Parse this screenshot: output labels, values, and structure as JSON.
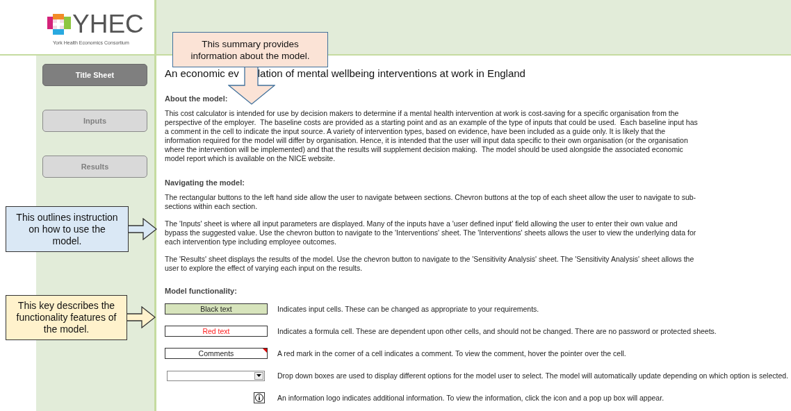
{
  "logo": {
    "name": "YHEC",
    "subtitle": "York Health Economics Consortium"
  },
  "nav": [
    {
      "label": "Title Sheet",
      "selected": true
    },
    {
      "label": "Inputs",
      "selected": false
    },
    {
      "label": "Results",
      "selected": false
    }
  ],
  "title_parts": [
    "An economic ev",
    "lation of mental wellbeing interventions at work in England"
  ],
  "sections": [
    {
      "heading": "About the model:",
      "paragraphs": [
        "This cost calculator is intended for use by decision makers to determine if a mental health intervention at work is cost-saving for a specific organisation from the perspective of the employer.  The baseline costs are provided as a starting point and as an example of the type of inputs that could be used.  Each baseline input has a comment in the cell to indicate the input source. A variety of intervention types, based on evidence, have been included as a guide only. It is likely that the information required for the model will differ by organisation. Hence, it is intended that the user will input data specific to their own organisation (or the organisation where the intervention will be implemented) and that the results will supplement decision making.  The model should be used alongside the associated economic model report which is available on the NICE website."
      ]
    },
    {
      "heading": "Navigating the model:",
      "paragraphs": [
        "The rectangular buttons to the left hand side allow the user to navigate between sections. Chevron buttons at the top of each sheet allow the user to navigate to sub-sections within each section.",
        "The 'Inputs' sheet is where all input parameters are displayed. Many of the inputs have a 'user defined input' field allowing the user to enter their own value and bypass the suggested value. Use the chevron button to navigate to the 'Interventions' sheet. The 'Interventions' sheets allows the user to view the underlying data for each intervention type including employee outcomes.",
        "The 'Results' sheet displays the results of the model. Use the chevron button to navigate to the 'Sensitivity Analysis' sheet. The 'Sensitivity Analysis' sheet allows the user to explore the effect of varying each input on the results."
      ]
    }
  ],
  "functionality": {
    "heading": "Model functionality:",
    "items": [
      {
        "kind": "input-cell",
        "label": "Black text",
        "description": "Indicates input cells. These can be changed as appropriate to your requirements."
      },
      {
        "kind": "formula-cell",
        "label": "Red text",
        "description": "Indicates a formula cell. These are dependent upon other cells, and should not be changed. There are no password or protected sheets."
      },
      {
        "kind": "comment-cell",
        "label": "Comments",
        "description": "A red mark in the corner of a cell indicates a comment. To view the comment, hover the pointer over the cell."
      },
      {
        "kind": "dropdown",
        "description": "Drop down boxes are used to display different options for the model user to select. The model will automatically update depending on which option is selected."
      },
      {
        "kind": "info",
        "description": "An information logo indicates additional information. To view the information, click the icon and a pop up box will appear."
      }
    ]
  },
  "callouts": [
    {
      "kind": "down",
      "color": "#fbe3d6",
      "text": "This summary provides information about the model."
    },
    {
      "kind": "right",
      "color": "#dae8f5",
      "text": "This outlines instruction on how to use the model."
    },
    {
      "kind": "right",
      "color": "#fff2cc",
      "text": "This key describes the functionality features of the model."
    }
  ]
}
